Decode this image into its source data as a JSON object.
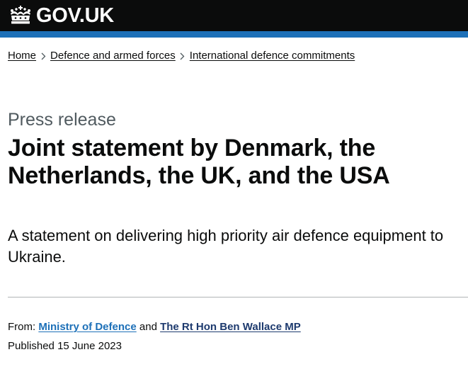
{
  "header": {
    "logo_text": "GOV.UK",
    "crown_icon": "crown-icon",
    "background_color": "#0b0c0c",
    "accent_bar_color": "#1d70b8"
  },
  "breadcrumbs": [
    {
      "label": "Home"
    },
    {
      "label": "Defence and armed forces"
    },
    {
      "label": "International defence commitments"
    }
  ],
  "page": {
    "caption": "Press release",
    "title": "Joint statement by Denmark, the Netherlands, the UK, and the USA",
    "lead": "A statement on delivering high priority air defence equipment to Ukraine."
  },
  "metadata": {
    "from_label": "From:",
    "organisation_1": "Ministry of Defence",
    "conjunction": "and",
    "organisation_2": "The Rt Hon Ben Wallace MP",
    "published_label": "Published",
    "published_date": "15 June 2023"
  },
  "colors": {
    "link": "#1d70b8",
    "visited_link": "#1d3a6e",
    "secondary_text": "#505a5f",
    "text": "#0b0c0c"
  }
}
